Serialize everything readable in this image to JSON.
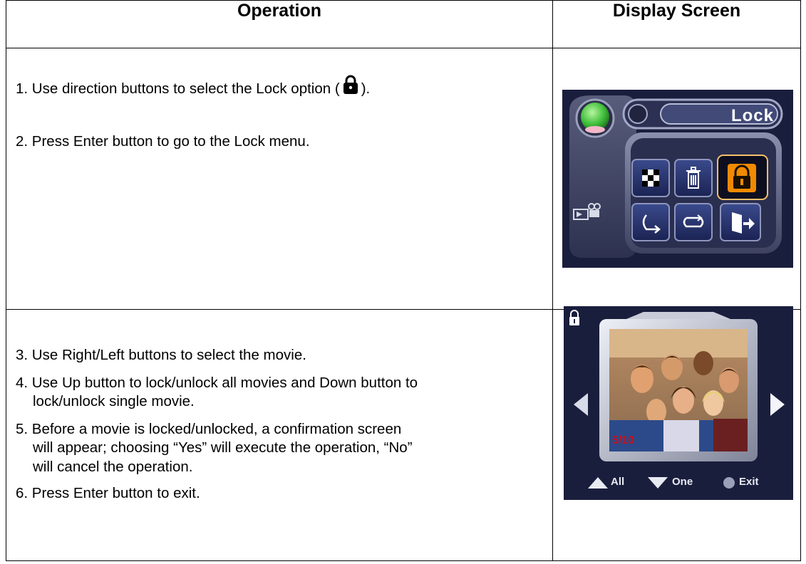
{
  "table": {
    "header_operation": "Operation",
    "header_display": "Display Screen"
  },
  "row1": {
    "step1_before": "1. Use direction buttons to select the Lock option (",
    "step1_after": ").",
    "step2": "2. Press Enter button to go to the Lock menu."
  },
  "row2": {
    "step3": "3. Use Right/Left buttons to select the movie.",
    "step4_l1": "4. Use Up button to lock/unlock all movies and Down button to",
    "step4_l2": "lock/unlock single movie.",
    "step5_l1": "5. Before a movie is locked/unlocked, a confirmation screen",
    "step5_l2": "will appear; choosing “Yes” will execute the operation, “No”",
    "step5_l3": "will cancel the operation.",
    "step6": "6. Press Enter button to exit."
  },
  "screen1": {
    "menu_title": "Lock",
    "icons": [
      "mosaic-icon",
      "trash-icon",
      "lock-icon",
      "rotate-icon",
      "loop-icon",
      "exit-icon"
    ]
  },
  "screen2": {
    "counter": "5/10",
    "hint_all": "All",
    "hint_one": "One",
    "hint_exit": "Exit"
  },
  "colors": {
    "screen_bg": "#1a1e3d",
    "selected_orange": "#f08a00",
    "panel_steel": "#5b6283"
  }
}
